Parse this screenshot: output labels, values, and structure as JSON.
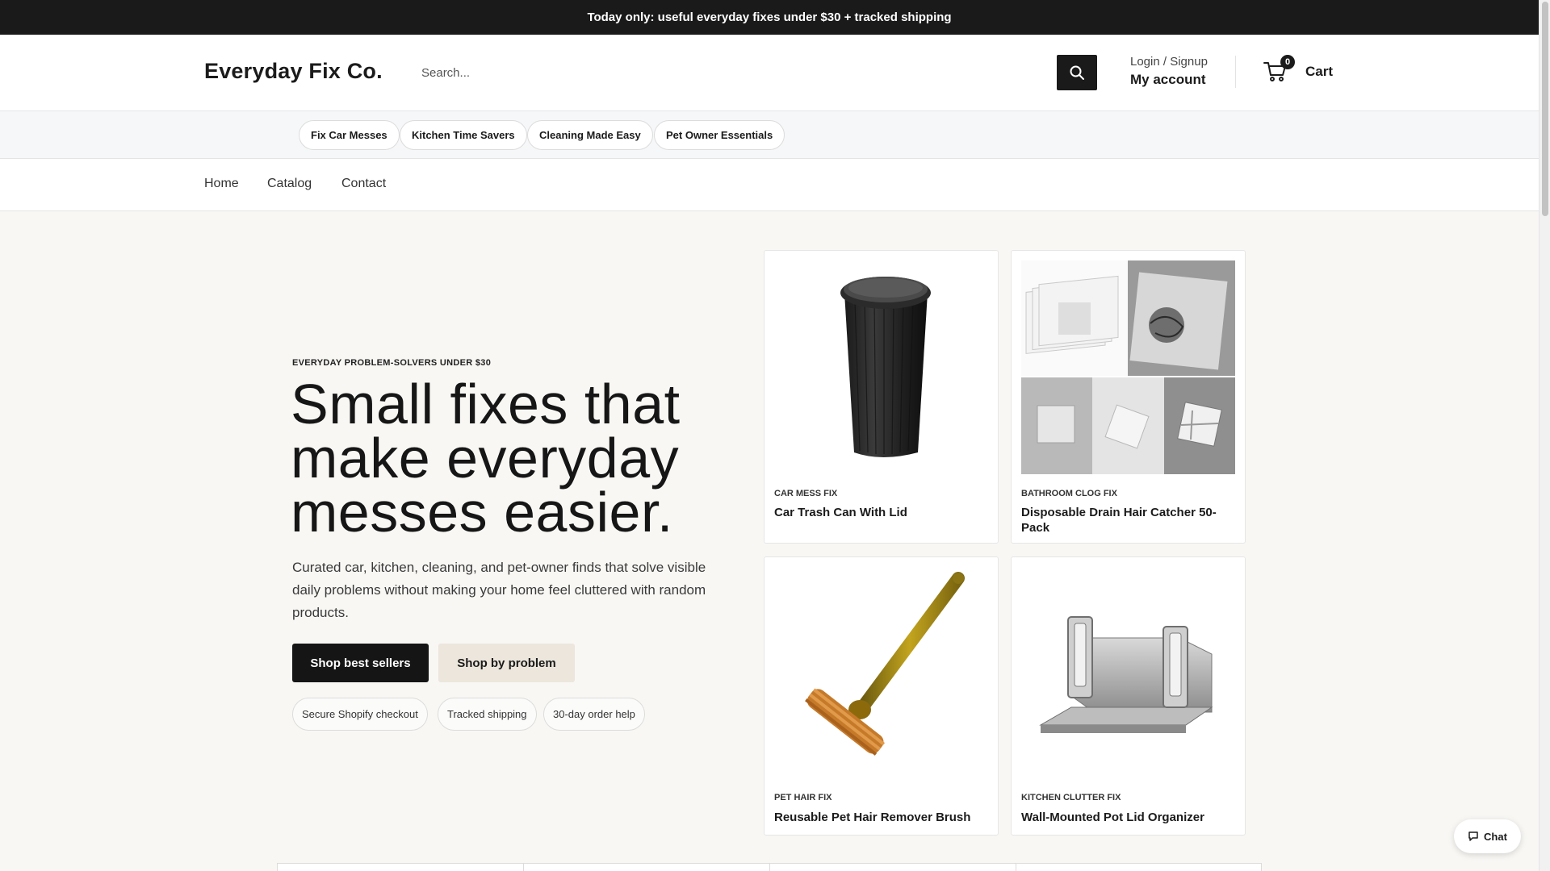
{
  "announcement": "Today only: useful everyday fixes under $30 + tracked shipping",
  "header": {
    "logo": "Everyday Fix Co.",
    "search_placeholder": "Search...",
    "login_label": "Login / Signup",
    "account_label": "My account",
    "cart_label": "Cart",
    "cart_count": "0"
  },
  "category_pills": [
    "Fix Car Messes",
    "Kitchen Time Savers",
    "Cleaning Made Easy",
    "Pet Owner Essentials"
  ],
  "nav": [
    "Home",
    "Catalog",
    "Contact"
  ],
  "hero": {
    "eyebrow": "EVERYDAY PROBLEM-SOLVERS UNDER $30",
    "headline": "Small fixes that make everyday messes easier.",
    "subcopy": "Curated car, kitchen, cleaning, and pet-owner finds that solve visible daily problems without making your home feel cluttered with random products.",
    "primary_cta": "Shop best sellers",
    "secondary_cta": "Shop by problem",
    "trust_badges": [
      "Secure Shopify checkout",
      "Tracked shipping",
      "30-day order help"
    ]
  },
  "products": [
    {
      "tag": "CAR MESS FIX",
      "title": "Car Trash Can With Lid",
      "icon": "car-trash-can-image"
    },
    {
      "tag": "BATHROOM CLOG FIX",
      "title": "Disposable Drain Hair Catcher 50-Pack",
      "icon": "drain-hair-catcher-image"
    },
    {
      "tag": "PET HAIR FIX",
      "title": "Reusable Pet Hair Remover Brush",
      "icon": "pet-hair-brush-image"
    },
    {
      "tag": "KITCHEN CLUTTER FIX",
      "title": "Wall-Mounted Pot Lid Organizer",
      "icon": "pot-lid-organizer-image"
    }
  ],
  "chat_label": "Chat",
  "colors": {
    "dark": "#1a1a1a",
    "secondary_button": "#ece6dc",
    "page_bg": "#f8f7f4"
  }
}
